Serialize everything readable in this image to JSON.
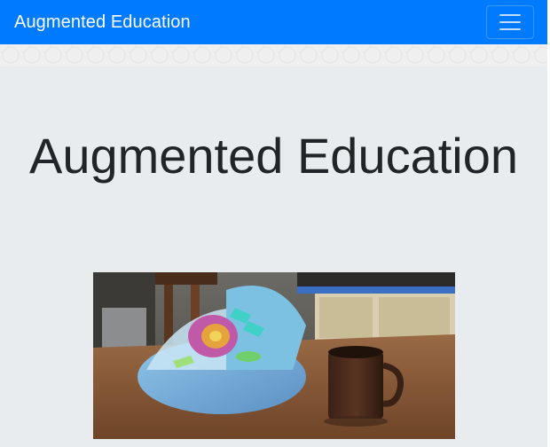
{
  "navbar": {
    "brand": "Augmented Education",
    "bg_color": "#007bff",
    "toggler_icon": "hamburger-menu-icon"
  },
  "hero": {
    "heading": "Augmented Education",
    "bg_color": "#e9ecef",
    "image": {
      "subject": "3D plant cell model on a wooden kitchen table next to a coffee mug"
    }
  }
}
